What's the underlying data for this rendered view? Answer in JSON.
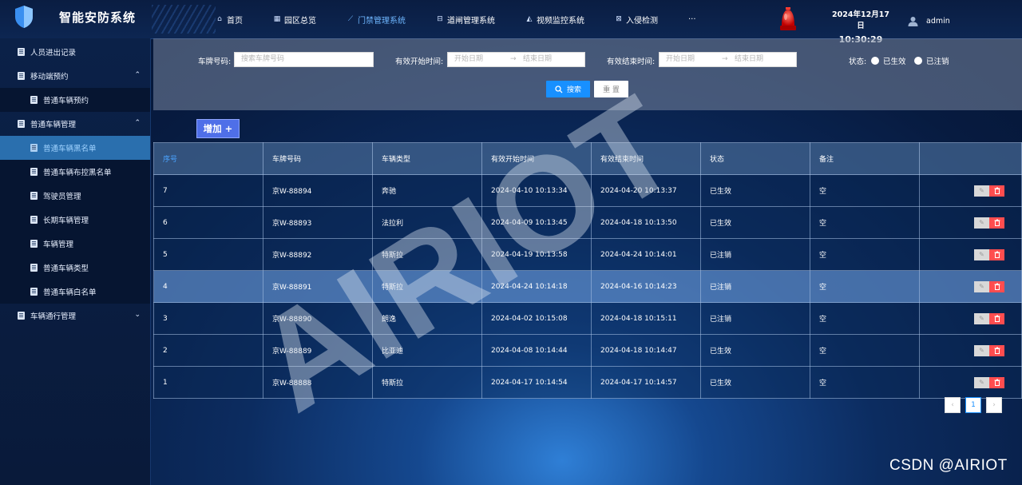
{
  "header": {
    "app_title": "智能安防系统",
    "nav": [
      {
        "label": "首页",
        "icon": "home-icon",
        "active": false
      },
      {
        "label": "园区总览",
        "icon": "grid-icon",
        "active": false
      },
      {
        "label": "门禁管理系统",
        "icon": "door-icon",
        "active": true
      },
      {
        "label": "道闸管理系统",
        "icon": "barrier-icon",
        "active": false
      },
      {
        "label": "视频监控系统",
        "icon": "camera-icon",
        "active": false
      },
      {
        "label": "入侵检测",
        "icon": "intrusion-icon",
        "active": false
      },
      {
        "label": "···",
        "icon": "more-icon",
        "active": false
      }
    ],
    "date": "2024年12月17日",
    "time": "10:30:29",
    "username": "admin"
  },
  "sidebar": {
    "items": [
      {
        "label": "人员进出记录",
        "level": 1,
        "caret": ""
      },
      {
        "label": "移动端预约",
        "level": 1,
        "caret": "⌃"
      },
      {
        "label": "普通车辆预约",
        "level": 2,
        "caret": ""
      },
      {
        "label": "普通车辆管理",
        "level": 1,
        "caret": "⌃"
      },
      {
        "label": "普通车辆黑名单",
        "level": 2,
        "caret": "",
        "active": true
      },
      {
        "label": "普通车辆布控黑名单",
        "level": 2,
        "caret": ""
      },
      {
        "label": "驾驶员管理",
        "level": 2,
        "caret": ""
      },
      {
        "label": "长期车辆管理",
        "level": 2,
        "caret": ""
      },
      {
        "label": "车辆管理",
        "level": 2,
        "caret": ""
      },
      {
        "label": "普通车辆类型",
        "level": 2,
        "caret": ""
      },
      {
        "label": "普通车辆白名单",
        "level": 2,
        "caret": ""
      },
      {
        "label": "车辆通行管理",
        "level": 1,
        "caret": "⌄"
      }
    ]
  },
  "filter": {
    "plate_label": "车牌号码:",
    "plate_placeholder": "搜索车牌号码",
    "start_label": "有效开始时间:",
    "end_label": "有效结束时间:",
    "date_start_placeholder": "开始日期",
    "date_end_placeholder": "结束日期",
    "range_sep": "→",
    "status_label": "状态:",
    "status_options": [
      "已生效",
      "已注销"
    ],
    "search_label": "搜索",
    "reset_label": "重 置"
  },
  "add_button": "增加 +",
  "table": {
    "columns": [
      "序号",
      "车牌号码",
      "车辆类型",
      "有效开始时间",
      "有效结束时间",
      "状态",
      "备注",
      ""
    ],
    "rows": [
      [
        "7",
        "京W-88894",
        "奔驰",
        "2024-04-10 10:13:34",
        "2024-04-20 10:13:37",
        "已生效",
        "空"
      ],
      [
        "6",
        "京W-88893",
        "法拉利",
        "2024-04-09 10:13:45",
        "2024-04-18 10:13:50",
        "已生效",
        "空"
      ],
      [
        "5",
        "京W-88892",
        "特斯拉",
        "2024-04-19 10:13:58",
        "2024-04-24 10:14:01",
        "已注销",
        "空"
      ],
      [
        "4",
        "京W-88891",
        "特斯拉",
        "2024-04-24 10:14:18",
        "2024-04-16 10:14:23",
        "已注销",
        "空"
      ],
      [
        "3",
        "京W-88890",
        "朗逸",
        "2024-04-02 10:15:08",
        "2024-04-18 10:15:11",
        "已注销",
        "空"
      ],
      [
        "2",
        "京W-88889",
        "比亚迪",
        "2024-04-08 10:14:44",
        "2024-04-18 10:14:47",
        "已生效",
        "空"
      ],
      [
        "1",
        "京W-88888",
        "特斯拉",
        "2024-04-17 10:14:54",
        "2024-04-17 10:14:57",
        "已生效",
        "空"
      ]
    ],
    "highlight_row": 3
  },
  "pagination": {
    "prev": "‹",
    "current": "1",
    "next": "›"
  },
  "watermark": "AIRIOT",
  "corner_text": "CSDN @AIRIOT",
  "colors": {
    "accent": "#1890ff",
    "danger": "#ff4d4f",
    "active_nav": "#6fb7ff",
    "add_button": "#4f6fe8"
  }
}
